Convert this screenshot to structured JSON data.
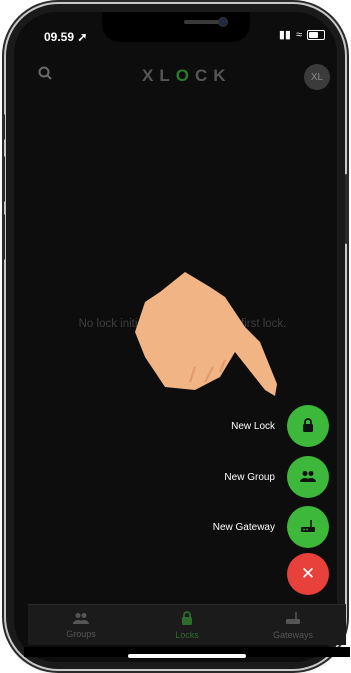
{
  "status_bar": {
    "time": "09.59",
    "location_icon": "location-arrow-icon",
    "signal": "signal-icon",
    "wifi": "wifi-icon",
    "battery": "battery-icon"
  },
  "header": {
    "search_icon": "search-icon",
    "logo_text": "XLOCK",
    "avatar_initials": "XL"
  },
  "main": {
    "empty_message": "No lock initialized yet. Add your first lock."
  },
  "fab_menu": {
    "items": [
      {
        "label": "New Lock",
        "icon": "lock-icon"
      },
      {
        "label": "New Group",
        "icon": "group-icon"
      },
      {
        "label": "New Gateway",
        "icon": "router-icon"
      }
    ],
    "close_icon": "close-icon"
  },
  "tabs": [
    {
      "label": "Groups",
      "icon": "group-icon"
    },
    {
      "label": "Locks",
      "icon": "lock-icon",
      "active": true
    },
    {
      "label": "Gateways",
      "icon": "router-icon"
    }
  ],
  "colors": {
    "accent_green": "#3db83a",
    "close_red": "#e8403a",
    "background": "#0d0d0d"
  }
}
